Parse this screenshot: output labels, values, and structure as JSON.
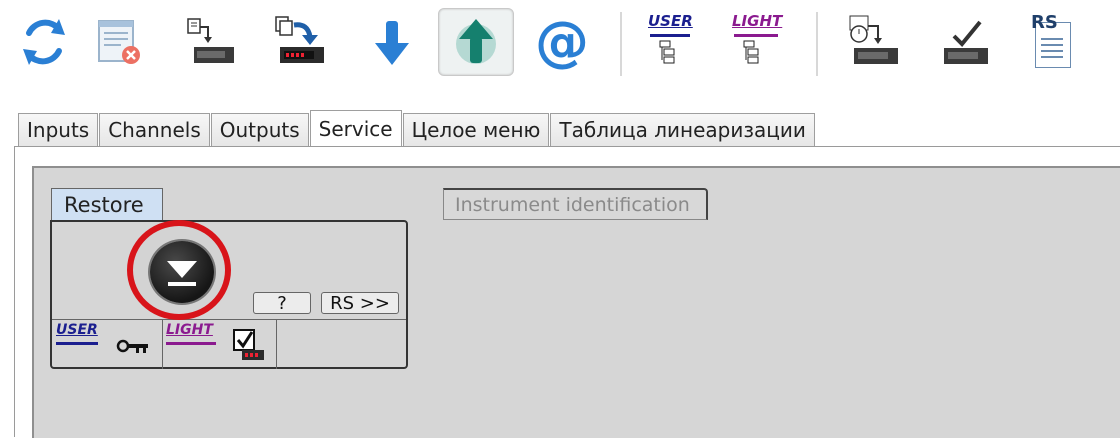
{
  "toolbar": {
    "buttons": [
      {
        "icon": "refresh-icon"
      },
      {
        "icon": "close-list-icon"
      },
      {
        "icon": "device-read-icon"
      },
      {
        "icon": "device-write-icon"
      },
      {
        "icon": "arrow-down-icon"
      },
      {
        "icon": "arrow-up-icon"
      },
      {
        "icon": "at-sign-icon"
      },
      {
        "icon": "user-mode-icon"
      },
      {
        "icon": "light-mode-icon"
      },
      {
        "icon": "device-clock-icon"
      },
      {
        "icon": "device-check-icon"
      },
      {
        "icon": "rs-document-icon"
      }
    ],
    "user_label": "USER",
    "light_label": "LIGHT",
    "rs_label": "RS",
    "at_glyph": "@"
  },
  "tabs": [
    {
      "label": "Inputs"
    },
    {
      "label": "Channels"
    },
    {
      "label": "Outputs"
    },
    {
      "label": "Service",
      "active": true
    },
    {
      "label": "Целое меню"
    },
    {
      "label": "Таблица линеаризации"
    }
  ],
  "restore": {
    "title": "Restore",
    "help_button": "?",
    "rs_button": "RS >>",
    "user_label": "USER",
    "light_label": "LIGHT"
  },
  "identification": {
    "title": "Instrument identification"
  },
  "colors": {
    "blue_icon": "#2a7fd4",
    "user_color": "#1b1f8f",
    "light_color": "#8b1a8f",
    "teal_arrow": "#15806e",
    "highlight_ring": "#d8141a"
  }
}
